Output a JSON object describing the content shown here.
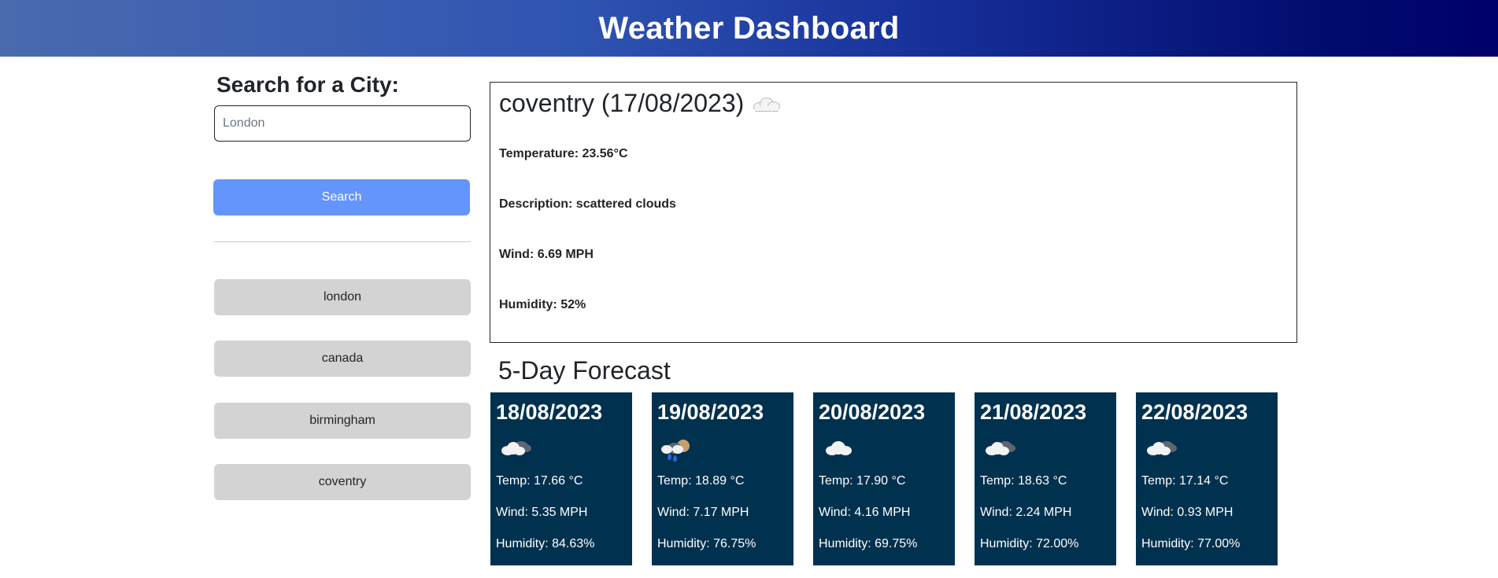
{
  "header": {
    "title": "Weather Dashboard"
  },
  "search": {
    "title": "Search for a City:",
    "placeholder": "London",
    "value": "",
    "button_label": "Search"
  },
  "history": {
    "items": [
      {
        "label": "london"
      },
      {
        "label": "canada"
      },
      {
        "label": "birmingham"
      },
      {
        "label": "coventry"
      }
    ]
  },
  "current": {
    "title": "coventry (17/08/2023)",
    "icon": "cloud-icon",
    "temperature": "Temperature: 23.56°C",
    "description": "Description: scattered clouds",
    "wind": "Wind: 6.69 MPH",
    "humidity": "Humidity: 52%"
  },
  "forecast": {
    "title": "5-Day Forecast",
    "days": [
      {
        "date": "18/08/2023",
        "icon": "broken-clouds-icon",
        "temp": "Temp: 17.66 °C",
        "wind": "Wind: 5.35 MPH",
        "humidity": "Humidity: 84.63%"
      },
      {
        "date": "19/08/2023",
        "icon": "rain-icon",
        "temp": "Temp: 18.89 °C",
        "wind": "Wind: 7.17 MPH",
        "humidity": "Humidity: 76.75%"
      },
      {
        "date": "20/08/2023",
        "icon": "cloud-icon",
        "temp": "Temp: 17.90 °C",
        "wind": "Wind: 4.16 MPH",
        "humidity": "Humidity: 69.75%"
      },
      {
        "date": "21/08/2023",
        "icon": "broken-clouds-icon",
        "temp": "Temp: 18.63 °C",
        "wind": "Wind: 2.24 MPH",
        "humidity": "Humidity: 72.00%"
      },
      {
        "date": "22/08/2023",
        "icon": "broken-clouds-icon",
        "temp": "Temp: 17.14 °C",
        "wind": "Wind: 0.93 MPH",
        "humidity": "Humidity: 77.00%"
      }
    ]
  },
  "colors": {
    "header_gradient_start": "#4a6aae",
    "header_gradient_end": "#00006a",
    "search_button": "#6495fd",
    "history_button": "#d3d3d3",
    "forecast_card": "#00314f"
  }
}
